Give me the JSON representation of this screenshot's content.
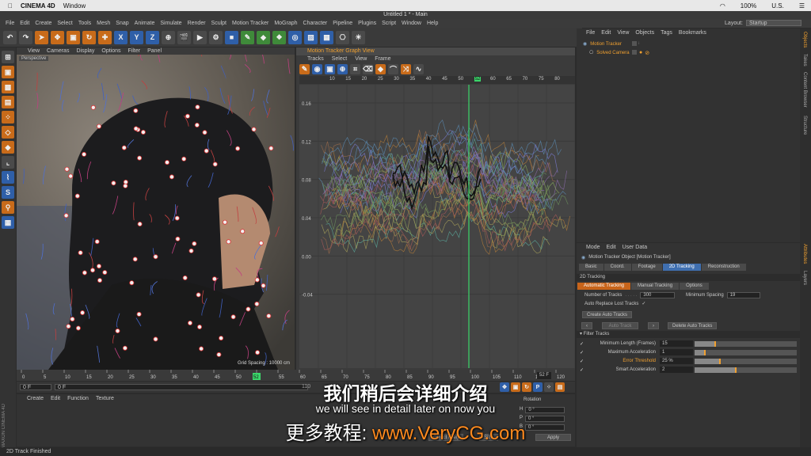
{
  "mac_menu": {
    "apple": "",
    "app": "CINEMA 4D",
    "window": "Window",
    "right": [
      "100%",
      "U.S.",
      "☰"
    ]
  },
  "window_title": "Untitled 1 * - Main",
  "menubar": [
    "File",
    "Edit",
    "Create",
    "Select",
    "Tools",
    "Mesh",
    "Snap",
    "Animate",
    "Simulate",
    "Render",
    "Sculpt",
    "Motion Tracker",
    "MoGraph",
    "Character",
    "Pipeline",
    "Plugins",
    "Script",
    "Window",
    "Help"
  ],
  "layout": {
    "label": "Layout:",
    "value": "Startup"
  },
  "viewport": {
    "menu": [
      "View",
      "Cameras",
      "Display",
      "Options",
      "Filter",
      "Panel"
    ],
    "label": "Perspective",
    "grid_spacing": "Grid Spacing : 10000 cm"
  },
  "graph": {
    "title": "Motion Tracker Graph View",
    "menu": [
      "Tracks",
      "Select",
      "View",
      "Frame"
    ],
    "ruler": [
      "10",
      "15",
      "20",
      "25",
      "30",
      "35",
      "40",
      "45",
      "50",
      "52",
      "60",
      "65",
      "70",
      "75",
      "80"
    ],
    "yticks": [
      "0.16",
      "0.12",
      "0.08",
      "0.04",
      "0.00",
      "-0.04"
    ]
  },
  "objects": {
    "menu": [
      "File",
      "Edit",
      "View",
      "Objects",
      "Tags",
      "Bookmarks"
    ],
    "items": [
      "Motion Tracker",
      "Solved Camera"
    ]
  },
  "attributes": {
    "menu": [
      "Mode",
      "Edit",
      "User Data"
    ],
    "object_title": "Motion Tracker Object [Motion Tracker]",
    "tabs": [
      "Basic",
      "Coord.",
      "Footage",
      "2D Tracking",
      "Reconstruction"
    ],
    "section": "2D Tracking",
    "subtabs": [
      "Automatic Tracking",
      "Manual Tracking",
      "Options"
    ],
    "num_tracks_label": "Number of Tracks",
    "num_tracks": "300",
    "min_spacing_label": "Minimum Spacing",
    "min_spacing": "19",
    "auto_replace": "Auto Replace Lost Tracks",
    "auto_replace_check": "✓",
    "create_btn": "Create Auto Tracks",
    "auto_track_btn": "Auto Track",
    "delete_btn": "Delete Auto Tracks",
    "filter_title": "Filter Tracks",
    "filters": [
      {
        "label": "Minimum Length (Frames)",
        "value": "15",
        "level": 0.2,
        "orange": false
      },
      {
        "label": "Maximum Acceleration",
        "value": "1",
        "level": 0.1,
        "orange": false
      },
      {
        "label": "Error Threshold",
        "value": "25 %",
        "level": 0.25,
        "orange": true
      },
      {
        "label": "Smart Acceleration",
        "value": "2",
        "level": 0.4,
        "orange": false
      }
    ]
  },
  "timeline": {
    "ticks": [
      "0",
      "5",
      "10",
      "15",
      "20",
      "25",
      "30",
      "35",
      "40",
      "45",
      "50",
      "52",
      "55",
      "60",
      "65",
      "70",
      "75",
      "80",
      "85",
      "90",
      "95",
      "100",
      "105",
      "110",
      "115",
      "120"
    ],
    "current": "52 F",
    "start": "0 F",
    "field2": "0 F",
    "end_field": "110"
  },
  "material": {
    "menu": [
      "Create",
      "Edit",
      "Function",
      "Texture"
    ]
  },
  "coords": {
    "header": "Rotation",
    "rows": [
      "H",
      "P",
      "B"
    ],
    "values": [
      "0 °",
      "0 °",
      "0 °"
    ],
    "apply": "Apply",
    "left": "Object (Rel)",
    "mid": "Size"
  },
  "right_strip": [
    "Objects",
    "Takes",
    "Content Browser",
    "Structure",
    "Attributes",
    "Layers"
  ],
  "status": "2D Track Finished",
  "subtitles": {
    "zh": "我们稍后会详细介绍",
    "en": "we will see in detail later on now you",
    "promo_prefix": "更多教程: ",
    "promo_url": "www.VeryCG.com"
  },
  "colors": {
    "accent": "#f0a030",
    "tab_blue": "#3f6fb0",
    "playhead": "#3bd66a"
  }
}
